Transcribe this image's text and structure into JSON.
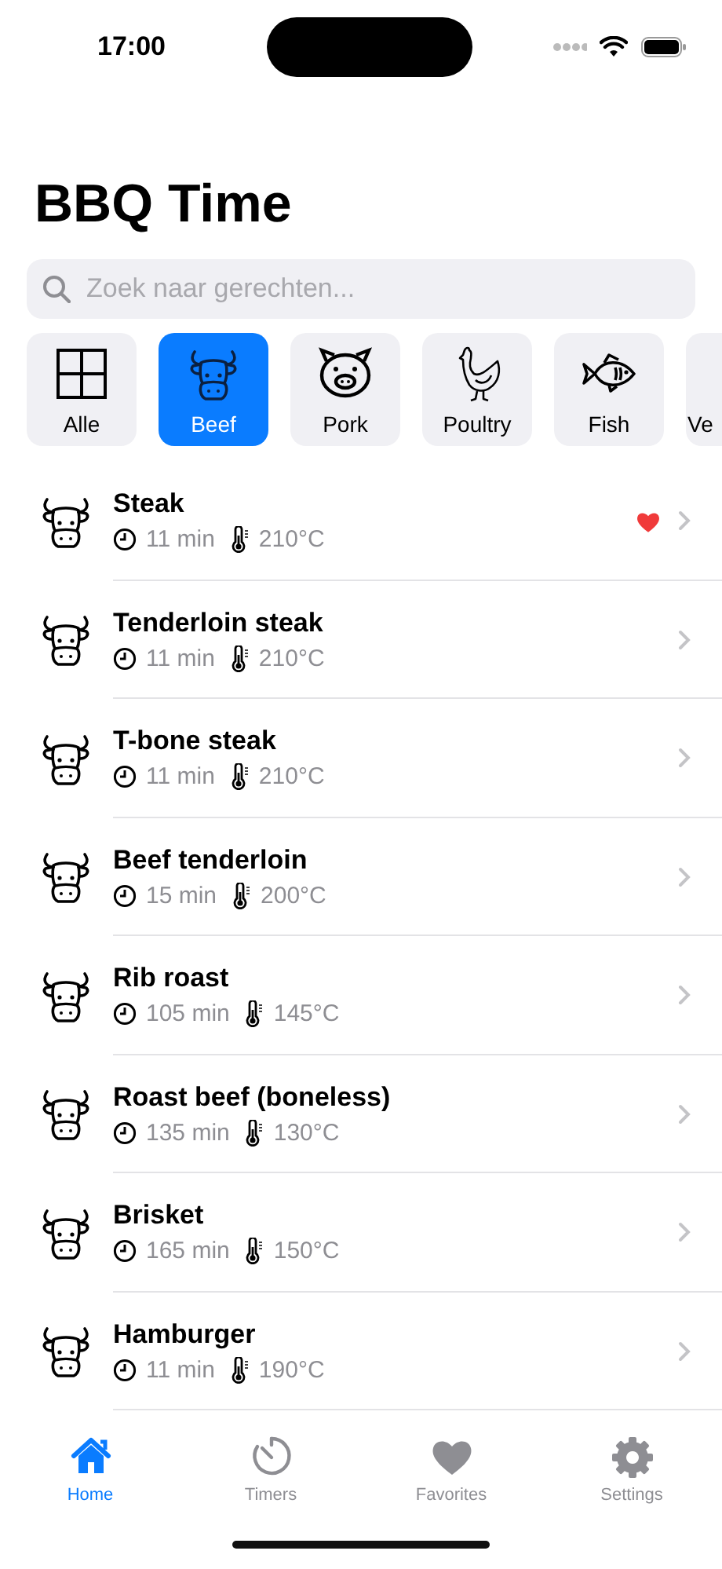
{
  "status_bar": {
    "time": "17:00"
  },
  "title": "BBQ Time",
  "search": {
    "placeholder": "Zoek naar gerechten..."
  },
  "categories": [
    {
      "label": "Alle",
      "kind": "grid",
      "selected": false
    },
    {
      "label": "Beef",
      "kind": "cow",
      "selected": true
    },
    {
      "label": "Pork",
      "kind": "pig",
      "selected": false
    },
    {
      "label": "Poultry",
      "kind": "chicken",
      "selected": false
    },
    {
      "label": "Fish",
      "kind": "fish",
      "selected": false
    },
    {
      "label": "Ve",
      "kind": "other",
      "selected": false
    }
  ],
  "recipes": [
    {
      "name": "Steak",
      "time": "11 min",
      "temperature": "210°C",
      "favorite": true
    },
    {
      "name": "Tenderloin steak",
      "time": "11 min",
      "temperature": "210°C",
      "favorite": false
    },
    {
      "name": "T-bone steak",
      "time": "11 min",
      "temperature": "210°C",
      "favorite": false
    },
    {
      "name": "Beef tenderloin",
      "time": "15 min",
      "temperature": "200°C",
      "favorite": false
    },
    {
      "name": "Rib roast",
      "time": "105 min",
      "temperature": "145°C",
      "favorite": false
    },
    {
      "name": "Roast beef (boneless)",
      "time": "135 min",
      "temperature": "130°C",
      "favorite": false
    },
    {
      "name": "Brisket",
      "time": "165 min",
      "temperature": "150°C",
      "favorite": false
    },
    {
      "name": "Hamburger",
      "time": "11 min",
      "temperature": "190°C",
      "favorite": false
    }
  ],
  "tab_bar": [
    {
      "label": "Home",
      "kind": "home",
      "selected": true
    },
    {
      "label": "Timers",
      "kind": "timer",
      "selected": false
    },
    {
      "label": "Favorites",
      "kind": "heart",
      "selected": false
    },
    {
      "label": "Settings",
      "kind": "gear",
      "selected": false
    }
  ]
}
